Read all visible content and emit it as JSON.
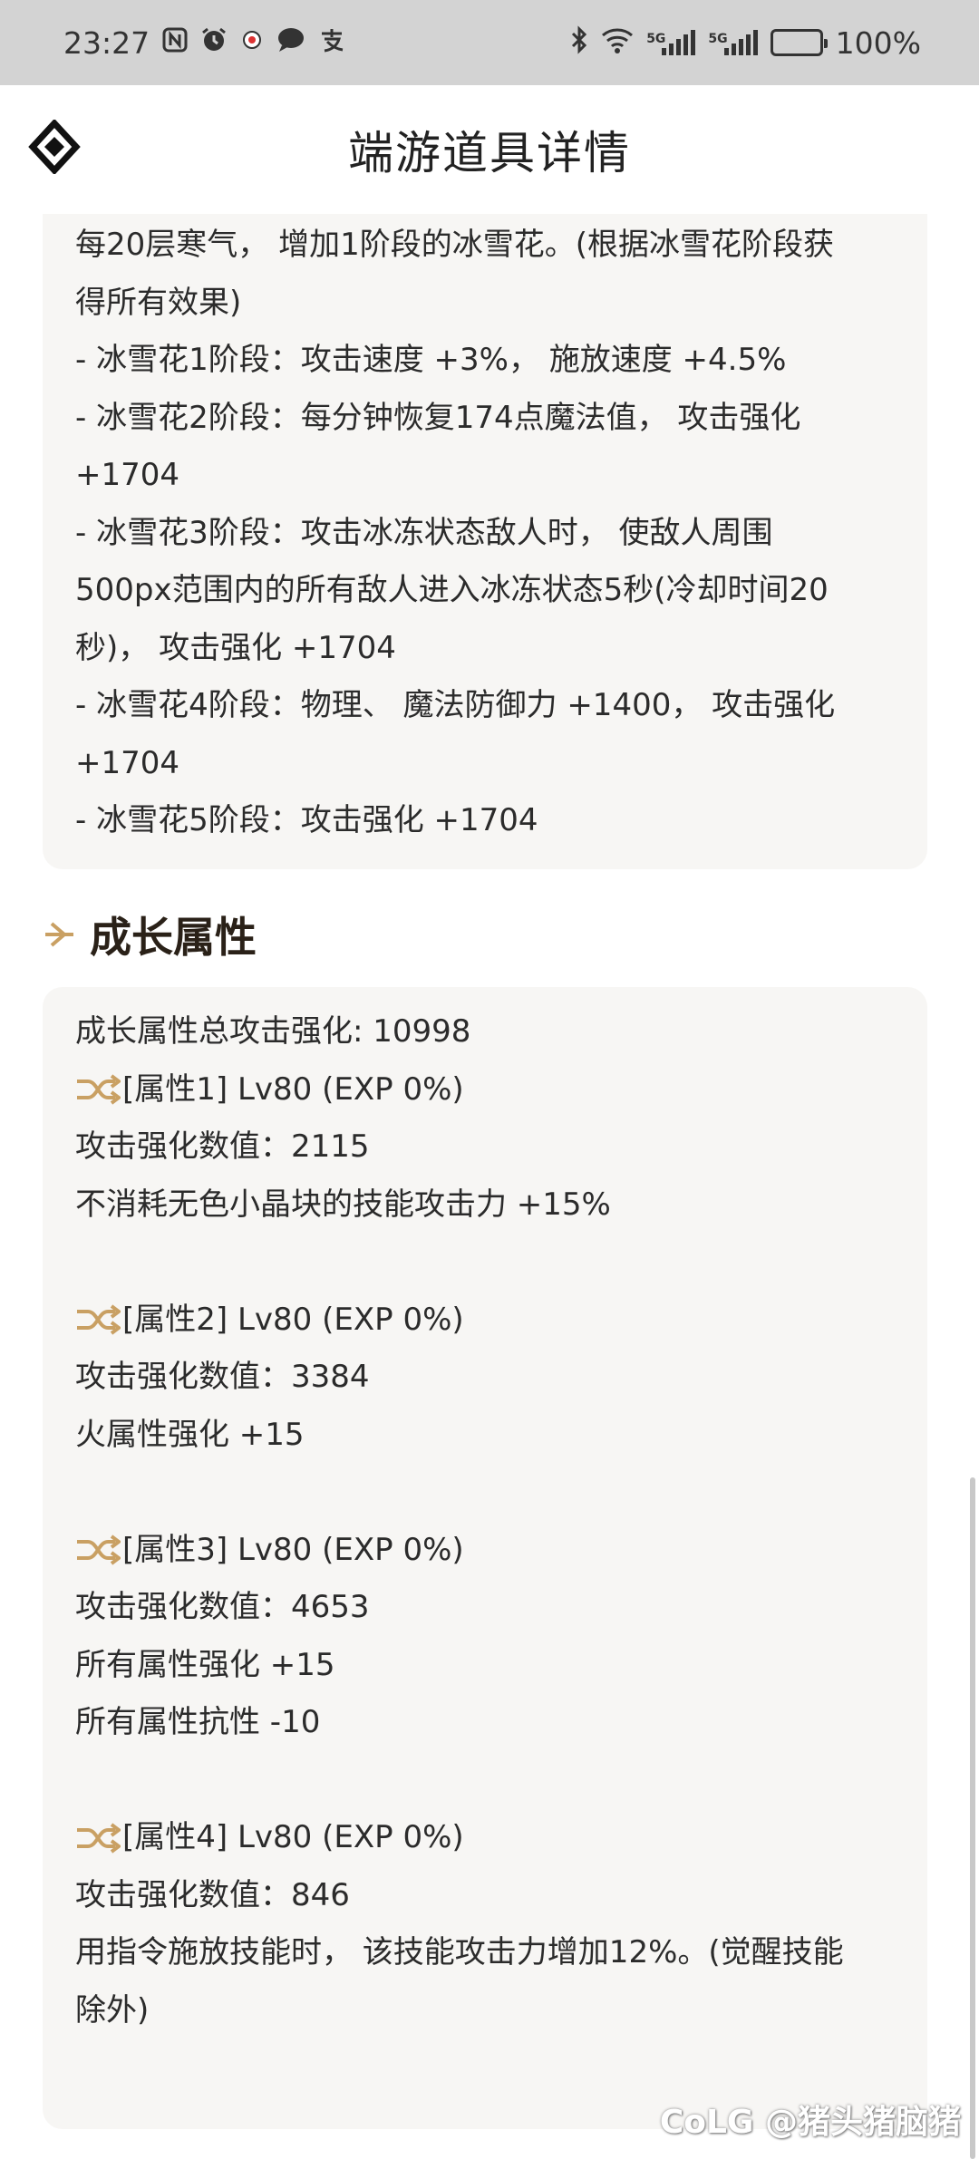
{
  "status_bar": {
    "time": "23:27",
    "left_icons": [
      "nfc-icon",
      "alarm-icon",
      "app-notification-icon",
      "chat-icon",
      "alipay-icon"
    ],
    "net1": "5G",
    "net2": "5G",
    "battery_text": "100%"
  },
  "header": {
    "title": "端游道具详情"
  },
  "description": {
    "lines": [
      "每20层寒气， 增加1阶段的冰雪花。(根据冰雪花阶段获",
      "得所有效果)",
      "- 冰雪花1阶段：攻击速度 +3%， 施放速度 +4.5%",
      "- 冰雪花2阶段：每分钟恢复174点魔法值， 攻击强化",
      "+1704",
      "- 冰雪花3阶段：攻击冰冻状态敌人时， 使敌人周围",
      "500px范围内的所有敌人进入冰冻状态5秒(冷却时间20",
      "秒)， 攻击强化 +1704",
      "- 冰雪花4阶段：物理、 魔法防御力 +1400， 攻击强化",
      "+1704",
      "- 冰雪花5阶段：攻击强化 +1704"
    ]
  },
  "growth": {
    "section_title": "成长属性",
    "total": "成长属性总攻击强化: 10998",
    "attributes": [
      {
        "head": "[属性1] Lv80 (EXP 0%)",
        "lines": [
          "攻击强化数值：2115",
          "不消耗无色小晶块的技能攻击力 +15%"
        ]
      },
      {
        "head": "[属性2] Lv80 (EXP 0%)",
        "lines": [
          "攻击强化数值：3384",
          "火属性强化 +15"
        ]
      },
      {
        "head": "[属性3] Lv80 (EXP 0%)",
        "lines": [
          "攻击强化数值：4653",
          "所有属性强化 +15",
          "所有属性抗性 -10"
        ]
      },
      {
        "head": "[属性4] Lv80 (EXP 0%)",
        "lines": [
          "攻击强化数值：846",
          "用指令施放技能时， 该技能攻击力增加12%。(觉醒技能",
          "除外)"
        ]
      }
    ]
  },
  "watermark": "CoLG @猪头猪脑猪",
  "colors": {
    "accent_gold": "#c9a063",
    "card_bg": "#f7f6f4",
    "status_bar_bg": "#d3d3d3"
  }
}
